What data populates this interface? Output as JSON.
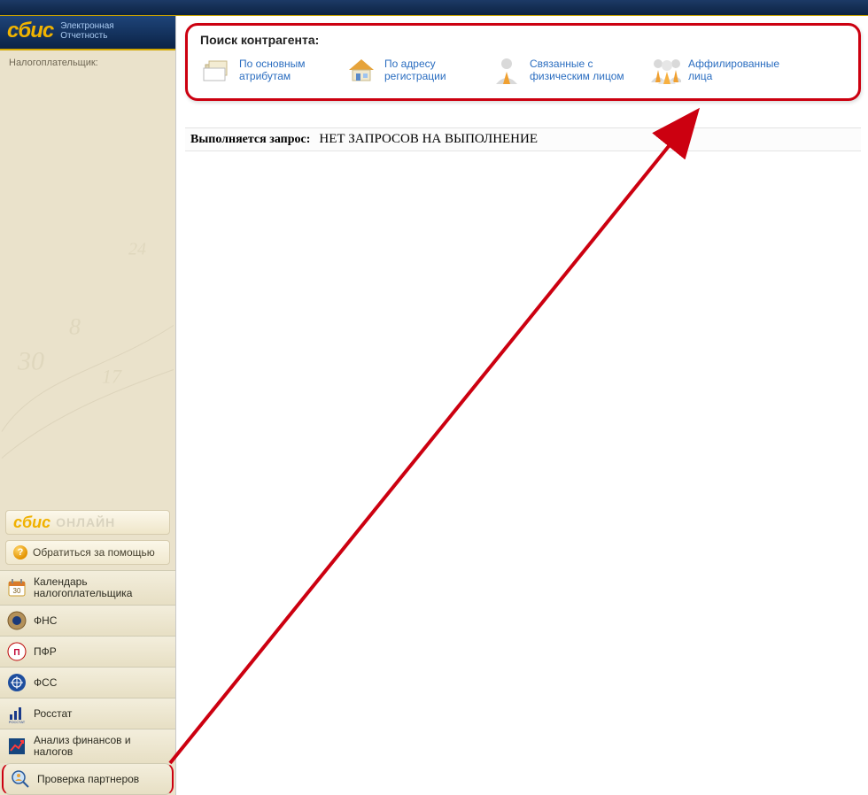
{
  "brand": {
    "logo": "сбис",
    "subtitle_line1": "Электронная",
    "subtitle_line2": "Отчетность"
  },
  "sidebar": {
    "taxpayer_label": "Налогоплательщик:",
    "sbis_online_logo": "сбис",
    "sbis_online_text": "ОНЛАЙН",
    "help_label": "Обратиться за помощью",
    "items": [
      {
        "label": "Календарь налогоплательщика"
      },
      {
        "label": "ФНС"
      },
      {
        "label": "ПФР"
      },
      {
        "label": "ФСС"
      },
      {
        "label": "Росстат"
      },
      {
        "label": "Анализ финансов и налогов"
      },
      {
        "label": "Проверка партнеров"
      }
    ]
  },
  "search": {
    "title": "Поиск контрагента:",
    "options": [
      {
        "label": "По основным атрибутам"
      },
      {
        "label": "По адресу регистрации"
      },
      {
        "label": "Связанные с физическим лицом"
      },
      {
        "label": "Аффилированные лица"
      }
    ]
  },
  "status": {
    "label": "Выполняется запрос:",
    "value": "НЕТ ЗАПРОСОВ НА ВЫПОЛНЕНИЕ"
  }
}
